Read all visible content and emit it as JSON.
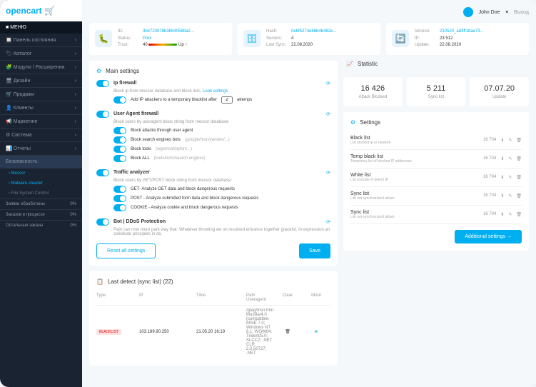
{
  "brand": "opencart",
  "user": {
    "name": "John Doe",
    "logout": "Выход"
  },
  "menu": {
    "header": "МЕНЮ",
    "items": [
      "Панель состояния",
      "Каталог",
      "Модули / Расширения",
      "Дизайн",
      "Продажи",
      "Клиенты",
      "Маркетинг",
      "Система",
      "Отчеты"
    ],
    "active": "Безопасность",
    "subs": [
      "Messor",
      "Malware-cleaner",
      "File System Control"
    ],
    "stats": [
      {
        "k": "Заявки обработаны",
        "v": "0%"
      },
      {
        "k": "Заказов в процессе",
        "v": "0%"
      },
      {
        "k": "Остальные заказы",
        "v": "0%"
      }
    ]
  },
  "info": [
    {
      "icon": "🐛",
      "rows": [
        {
          "k": "ID:",
          "v": "3b472307bb3b940588a2...",
          "blue": true
        },
        {
          "k": "Status:",
          "v": "Poor",
          "blue": true
        },
        {
          "k": "Trust:",
          "v": "40",
          "bar": true,
          "suffix": "Up ↑"
        }
      ]
    },
    {
      "icon": "🗄",
      "rows": [
        {
          "k": "Hash:",
          "v": "0e6f5274e86b4b482e...",
          "blue": true
        },
        {
          "k": "Servers:",
          "v": "4"
        },
        {
          "k": "Last Sync:",
          "v": "22.08.2020"
        }
      ]
    },
    {
      "icon": "🔄",
      "rows": [
        {
          "k": "Version:",
          "v": "210520_ad3ff18ae73...",
          "blue": true
        },
        {
          "k": "IP:",
          "v": "23 512"
        },
        {
          "k": "Update:",
          "v": "22.08.2020"
        }
      ]
    }
  ],
  "mainSettings": {
    "title": "Main settings",
    "blocks": [
      {
        "name": "Ip firewall",
        "desc": "Block ip from messor database and block lists. ",
        "link": "Look settings",
        "sub": [
          {
            "label": "Add IP attackers to a temporary blacklist after",
            "input": "2",
            "suffix": "attemps"
          }
        ]
      },
      {
        "name": "User Agent firewall",
        "desc": "Block users by useragent block string from messor database:",
        "sub": [
          {
            "label": "Block attacks through user agent"
          },
          {
            "label": "Block search engines bots",
            "hint": "(google/msn/yandex/...)"
          },
          {
            "label": "Block tools",
            "hint": "(wget/curl/pyton/...)"
          },
          {
            "label": "Block ALL",
            "hint": "(tools/bots/search engines)"
          }
        ]
      },
      {
        "name": "Traffic analyzer",
        "desc": "Block users by GET/POST block string from messor database:",
        "sub": [
          {
            "label": "GET- Analyze GET data and block dangerous requests"
          },
          {
            "label": "POST - Analyze submitted form data and block dangerous requests"
          },
          {
            "label": "COOKIE - Analyze cookie and block dangerous requests"
          }
        ]
      },
      {
        "name": "Bot | DDoS Protection",
        "desc": "Pain can now more park way that. Whatever throwing we on resolved entrance together graceful. In expression an solicitude principles in do."
      }
    ],
    "reset": "Reset all settings",
    "save": "Save"
  },
  "statistic": {
    "title": "Statistic",
    "items": [
      {
        "num": "16 426",
        "lbl": "Attack Blocked"
      },
      {
        "num": "5 211",
        "lbl": "Sync list"
      },
      {
        "num": "07.07.20",
        "lbl": "Update"
      }
    ]
  },
  "settings": {
    "title": "Settings",
    "items": [
      {
        "name": "Black list",
        "desc": "List blocked ip or network",
        "count": "16 704"
      },
      {
        "name": "Temp black list",
        "desc": "Temporary list of blocked IP addresses",
        "count": "16 704"
      },
      {
        "name": "White list",
        "desc": "List exclude of detect IP",
        "count": "16 704"
      },
      {
        "name": "Sync list",
        "desc": "List not synchronized attack",
        "count": "16 704"
      },
      {
        "name": "Sync list",
        "desc": "List not synchronized attack",
        "count": "16 704"
      }
    ],
    "more": "Additional settings →"
  },
  "detect": {
    "title": "Last detect (sync list) (22)",
    "cols": [
      "Type",
      "IP",
      "Time",
      "Path Useragent",
      "Clear",
      "More"
    ],
    "row": {
      "type": "BLACKLIST",
      "ip": "103.189.90.250",
      "time": "21.05.20 16:19",
      "ua": "/gtag/msn.htm\nMozilla/4.0 (compatible; MSIE 7.0; Windows NT 6.1; WOW64; Trident/5.0; SLCC2; .NET CLR 2.0.50727; .NET"
    }
  }
}
